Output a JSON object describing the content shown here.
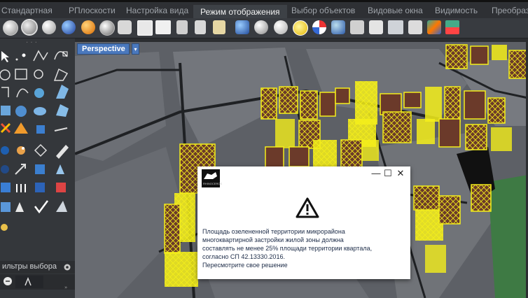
{
  "ribbon": {
    "tabs": [
      {
        "label": "Стандартная"
      },
      {
        "label": "РПлоскости"
      },
      {
        "label": "Настройка вида"
      },
      {
        "label": "Режим отображения",
        "active": true
      },
      {
        "label": "Выбор объектов"
      },
      {
        "label": "Видовые окна"
      },
      {
        "label": "Видимость"
      },
      {
        "label": "Преобразо"
      }
    ]
  },
  "viewport": {
    "label": "Perspective",
    "dropdown_glyph": "▾"
  },
  "left_panel": {
    "filters_label": "ильтры выбора"
  },
  "dialog": {
    "logo_label": "RHINOCEROS",
    "minimize_glyph": "—",
    "maximize_glyph": "☐",
    "close_glyph": "✕",
    "message_lines": [
      "Площадь озелененной территории микрорайона",
      "многоквартирной застройки жилой зоны должна",
      "составлять не менее 25% площади территории квартала,",
      "согласно СП 42.13330.2016.",
      "Пересмотрите свое решение"
    ]
  },
  "colors": {
    "accent": "#4a78bd",
    "wireframe": "#f4ee1a",
    "roof": "#6b3a2a",
    "green_area": "#3e7a44"
  }
}
